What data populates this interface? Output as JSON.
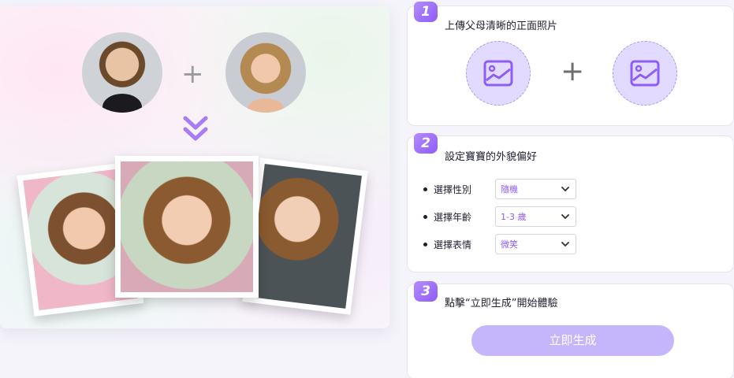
{
  "preview": {
    "plus_sign": "+"
  },
  "steps": [
    {
      "number": "1",
      "title": "上傳父母清晰的正面照片",
      "plus_sign": "+"
    },
    {
      "number": "2",
      "title": "設定寶寶的外貌偏好"
    },
    {
      "number": "3",
      "title": "點擊“立即生成”開始體驗"
    }
  ],
  "preferences": {
    "gender": {
      "label": "選擇性別",
      "value": "隨機"
    },
    "age": {
      "label": "選擇年齡",
      "value": "1-3 歲"
    },
    "expression": {
      "label": "選擇表情",
      "value": "微笑"
    }
  },
  "generate_button": "立即生成",
  "colors": {
    "accent": "#8e5cf7",
    "button": "#c5b6fb",
    "upload_bg": "#e2dbff"
  }
}
